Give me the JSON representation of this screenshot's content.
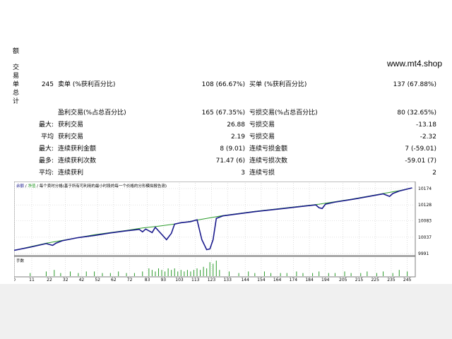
{
  "watermark": "www.mt4.shop",
  "side_vertical": [
    "交",
    "易",
    "单",
    "总",
    "计"
  ],
  "side_top": "额",
  "rows": {
    "r1": {
      "c1": "245",
      "l1": "卖单 (%获利百分比)",
      "v2": "108 (66.67%)",
      "l2": "买单 (%获利百分比)",
      "v3": "137 (67.88%)"
    },
    "r2": {
      "l1": "盈利交易(%占总百分比)",
      "v2": "165 (67.35%)",
      "l2": "亏损交易(%占总百分比)",
      "v3": "80 (32.65%)"
    },
    "r3": {
      "p": "最大:",
      "l1": "获利交易",
      "v2": "26.88",
      "l2": "亏损交易",
      "v3": "-13.18"
    },
    "r4": {
      "p": "平均",
      "l1": "获利交易",
      "v2": "2.19",
      "l2": "亏损交易",
      "v3": "-2.32"
    },
    "r5": {
      "p": "最大:",
      "l1": "连续获利金额",
      "v2": "8 (9.01)",
      "l2": "连续亏损金额",
      "v3": "7 (-59.01)"
    },
    "r6": {
      "p": "最多:",
      "l1": "连续获利次数",
      "v2": "71.47 (6)",
      "l2": "连续亏损次数",
      "v3": "-59.01 (7)"
    },
    "r7": {
      "p": "平均:",
      "l1": "连续获利",
      "v2": "3",
      "l2": "连续亏损",
      "v3": "2"
    }
  },
  "chart_data": {
    "type": "line",
    "legend_text": "余额 / 净值 / 每个卖时分格(基于所有可利用的最小时段的每一个价格的分形模拟报告测)",
    "legend_balance": "余额",
    "legend_equity": "净值",
    "legend_rest": "每个卖时分格(基于所有可利用的最小时段的每一个价格的分形模拟报告测)",
    "volume_label": "手数",
    "y_ticks": [
      "10174",
      "10128",
      "10083",
      "10037",
      "9991"
    ],
    "y_values": [
      10174,
      10128,
      10083,
      10037,
      9991
    ],
    "ylim": [
      9991,
      10174
    ],
    "x_ticks": [
      "0",
      "11",
      "22",
      "32",
      "42",
      "52",
      "62",
      "72",
      "83",
      "93",
      "103",
      "113",
      "123",
      "133",
      "144",
      "154",
      "164",
      "174",
      "184",
      "194",
      "205",
      "215",
      "225",
      "235",
      "245"
    ],
    "xlim": [
      0,
      250
    ],
    "colors": {
      "balance": "#1a1a8c",
      "equity": "#2a9a2a",
      "volume": "#2a9a2a",
      "grid": "#c8c8c8"
    },
    "balance": [
      [
        0,
        10000
      ],
      [
        10,
        10010
      ],
      [
        20,
        10020
      ],
      [
        30,
        10028
      ],
      [
        40,
        10036
      ],
      [
        50,
        10044
      ],
      [
        60,
        10050
      ],
      [
        70,
        10056
      ],
      [
        80,
        10063
      ],
      [
        90,
        10068
      ],
      [
        100,
        10074
      ],
      [
        110,
        10082
      ],
      [
        120,
        10090
      ],
      [
        130,
        10098
      ],
      [
        140,
        10104
      ],
      [
        150,
        10110
      ],
      [
        160,
        10115
      ],
      [
        170,
        10120
      ],
      [
        180,
        10125
      ],
      [
        190,
        10130
      ],
      [
        200,
        10137
      ],
      [
        210,
        10144
      ],
      [
        220,
        10152
      ],
      [
        230,
        10160
      ],
      [
        240,
        10168
      ],
      [
        248,
        10176
      ]
    ],
    "equity": [
      [
        0,
        10000
      ],
      [
        10,
        10009
      ],
      [
        20,
        10019
      ],
      [
        24,
        10014
      ],
      [
        26,
        10020
      ],
      [
        30,
        10027
      ],
      [
        40,
        10036
      ],
      [
        50,
        10042
      ],
      [
        60,
        10049
      ],
      [
        70,
        10055
      ],
      [
        78,
        10059
      ],
      [
        80,
        10052
      ],
      [
        82,
        10060
      ],
      [
        86,
        10050
      ],
      [
        88,
        10065
      ],
      [
        92,
        10045
      ],
      [
        95,
        10030
      ],
      [
        98,
        10048
      ],
      [
        100,
        10074
      ],
      [
        104,
        10078
      ],
      [
        110,
        10081
      ],
      [
        114,
        10086
      ],
      [
        117,
        10030
      ],
      [
        120,
        10002
      ],
      [
        122,
        10004
      ],
      [
        124,
        10030
      ],
      [
        126,
        10090
      ],
      [
        130,
        10097
      ],
      [
        140,
        10103
      ],
      [
        150,
        10109
      ],
      [
        160,
        10114
      ],
      [
        170,
        10119
      ],
      [
        180,
        10124
      ],
      [
        188,
        10128
      ],
      [
        190,
        10120
      ],
      [
        192,
        10118
      ],
      [
        194,
        10130
      ],
      [
        200,
        10136
      ],
      [
        210,
        10143
      ],
      [
        220,
        10151
      ],
      [
        230,
        10159
      ],
      [
        234,
        10152
      ],
      [
        236,
        10160
      ],
      [
        240,
        10167
      ],
      [
        248,
        10176
      ]
    ],
    "volume": [
      [
        10,
        2
      ],
      [
        20,
        3
      ],
      [
        25,
        4
      ],
      [
        29,
        2
      ],
      [
        35,
        3
      ],
      [
        40,
        2
      ],
      [
        45,
        3
      ],
      [
        50,
        3
      ],
      [
        55,
        2
      ],
      [
        60,
        2
      ],
      [
        65,
        3
      ],
      [
        70,
        2
      ],
      [
        75,
        2
      ],
      [
        80,
        3
      ],
      [
        84,
        5
      ],
      [
        86,
        4
      ],
      [
        88,
        3
      ],
      [
        90,
        5
      ],
      [
        92,
        4
      ],
      [
        94,
        3
      ],
      [
        96,
        5
      ],
      [
        98,
        4
      ],
      [
        100,
        5
      ],
      [
        102,
        3
      ],
      [
        104,
        4
      ],
      [
        106,
        3
      ],
      [
        108,
        4
      ],
      [
        110,
        3
      ],
      [
        112,
        4
      ],
      [
        114,
        5
      ],
      [
        116,
        4
      ],
      [
        118,
        6
      ],
      [
        120,
        5
      ],
      [
        122,
        9
      ],
      [
        124,
        8
      ],
      [
        126,
        10
      ],
      [
        128,
        4
      ],
      [
        134,
        3
      ],
      [
        140,
        2
      ],
      [
        146,
        3
      ],
      [
        150,
        2
      ],
      [
        156,
        3
      ],
      [
        160,
        2
      ],
      [
        166,
        2
      ],
      [
        170,
        2
      ],
      [
        176,
        3
      ],
      [
        180,
        2
      ],
      [
        186,
        2
      ],
      [
        190,
        3
      ],
      [
        196,
        2
      ],
      [
        200,
        2
      ],
      [
        206,
        3
      ],
      [
        210,
        2
      ],
      [
        216,
        2
      ],
      [
        220,
        3
      ],
      [
        226,
        2
      ],
      [
        230,
        3
      ],
      [
        236,
        2
      ],
      [
        240,
        4
      ],
      [
        245,
        3
      ]
    ]
  }
}
